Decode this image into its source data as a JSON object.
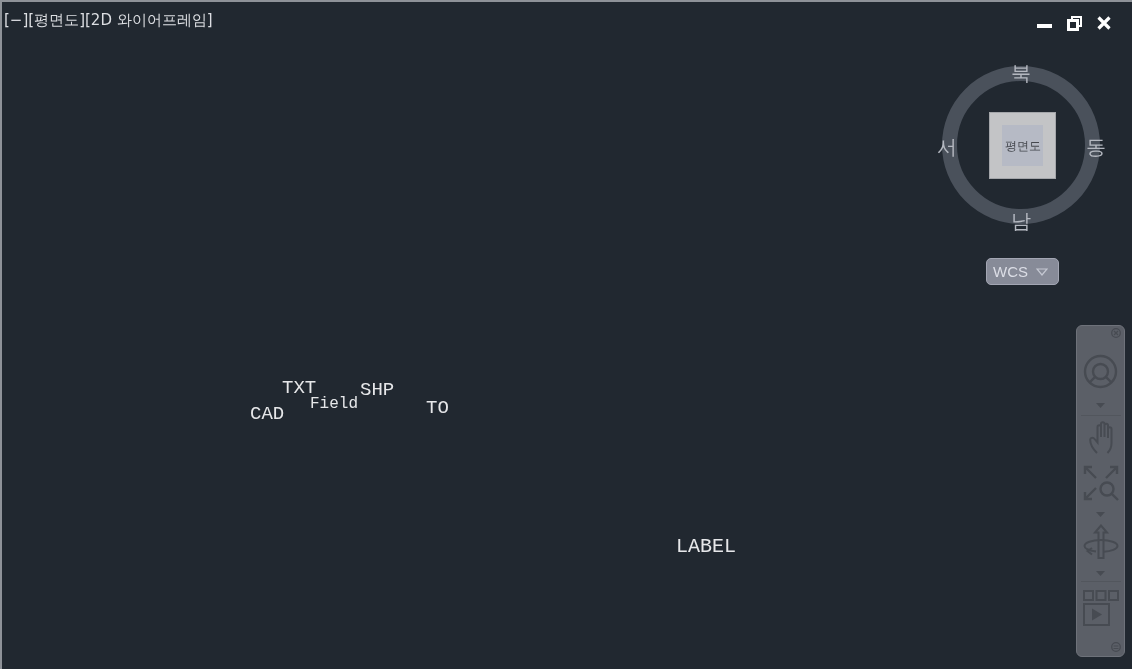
{
  "viewport": {
    "controls": [
      {
        "label": "[−]"
      },
      {
        "label": "[평면도]"
      },
      {
        "label": "[2D 와이어프레임]"
      }
    ]
  },
  "viewcube": {
    "north": "북",
    "west": "서",
    "east": "동",
    "south": "남",
    "face": "평면도"
  },
  "ucs_menu": {
    "label": "WCS"
  },
  "drawing_texts": [
    {
      "text": "TXT"
    },
    {
      "text": "SHP"
    },
    {
      "text": "Field"
    },
    {
      "text": "TO"
    },
    {
      "text": "CAD"
    },
    {
      "text": "LABEL"
    }
  ]
}
